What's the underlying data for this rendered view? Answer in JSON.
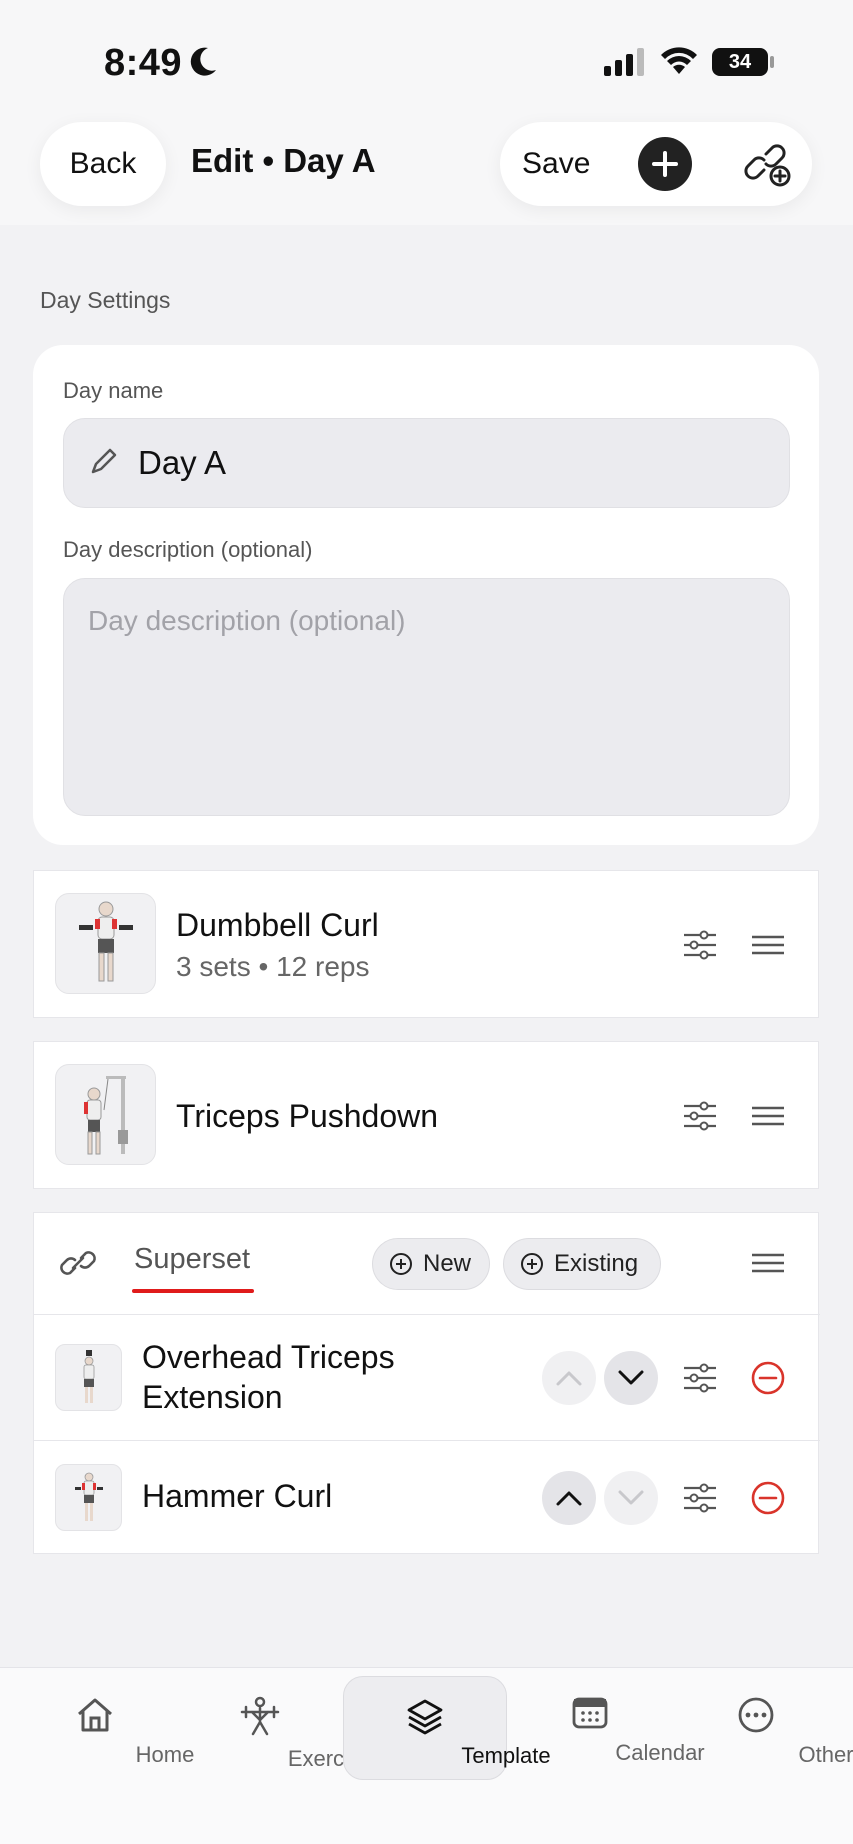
{
  "status": {
    "time": "8:49",
    "battery": "34"
  },
  "header": {
    "back_label": "Back",
    "title": "Edit • Day A",
    "save_label": "Save"
  },
  "section": {
    "label": "Day Settings"
  },
  "settings": {
    "name_label": "Day name",
    "name_value": "Day A",
    "desc_label": "Day description (optional)",
    "desc_placeholder": "Day description (optional)"
  },
  "exercises": [
    {
      "name": "Dumbbell Curl",
      "sub": "3 sets • 12 reps"
    },
    {
      "name": "Triceps Pushdown",
      "sub": ""
    }
  ],
  "superset": {
    "label": "Superset",
    "new_label": "New",
    "existing_label": "Existing",
    "items": [
      {
        "name_line1": "Overhead Triceps",
        "name_line2": "Extension"
      },
      {
        "name": "Hammer Curl"
      }
    ]
  },
  "tabs": [
    {
      "label": "Home"
    },
    {
      "label": "Exercise"
    },
    {
      "label": "Template"
    },
    {
      "label": "Calendar"
    },
    {
      "label": "Other"
    }
  ],
  "colors": {
    "danger": "#d9342b",
    "accent_underline": "#e01b1b"
  }
}
